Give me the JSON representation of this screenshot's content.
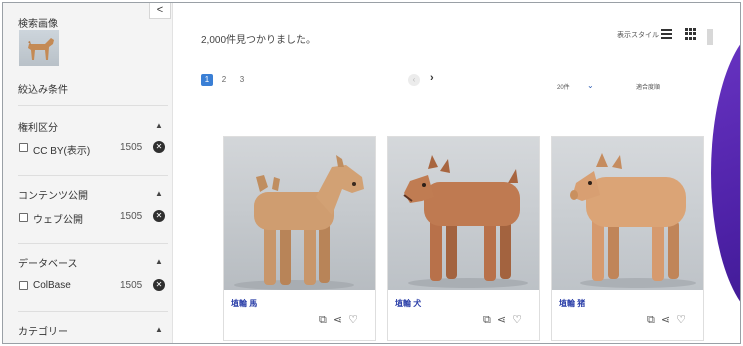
{
  "sidebar": {
    "collapse_glyph": "<",
    "search_image_label": "検索画像",
    "filter_conditions_label": "絞込み条件",
    "sections": [
      {
        "title": "権利区分",
        "option": "CC BY(表示)",
        "count": "1505"
      },
      {
        "title": "コンテンツ公開",
        "option": "ウェブ公開",
        "count": "1505"
      },
      {
        "title": "データベース",
        "option": "ColBase",
        "count": "1505"
      },
      {
        "title": "カテゴリー"
      }
    ],
    "caret_glyph": "▲",
    "clear_glyph": "✕"
  },
  "toolbar": {
    "results_text": "2,000件見つかりました。",
    "display_style_label": "表示スタイル",
    "list_view_icon": "list-icon",
    "grid_view_icon": "grid-icon"
  },
  "pagination": {
    "pages": [
      "1",
      "2",
      "3"
    ],
    "current_page": "1",
    "prev_glyph": "‹",
    "next_glyph": "›",
    "per_page": "20件",
    "per_page_caret": "⌄",
    "sort_label": "適合度順"
  },
  "results": [
    {
      "title": "埴輪 馬",
      "icons": [
        "image-search-icon",
        "share-icon",
        "heart-icon"
      ]
    },
    {
      "title": "埴輪 犬",
      "icons": [
        "image-search-icon",
        "share-icon",
        "heart-icon"
      ]
    },
    {
      "title": "埴輪 猪",
      "icons": [
        "image-search-icon",
        "share-icon",
        "heart-icon"
      ]
    }
  ],
  "card_icons": {
    "similar": "⧉",
    "share": "⋖",
    "favorite": "♡"
  },
  "colors": {
    "accent": "#3a7fd5",
    "title_link": "#2a3ea8",
    "purple": "#5b2bb5",
    "terracotta": "#c98c5f"
  }
}
